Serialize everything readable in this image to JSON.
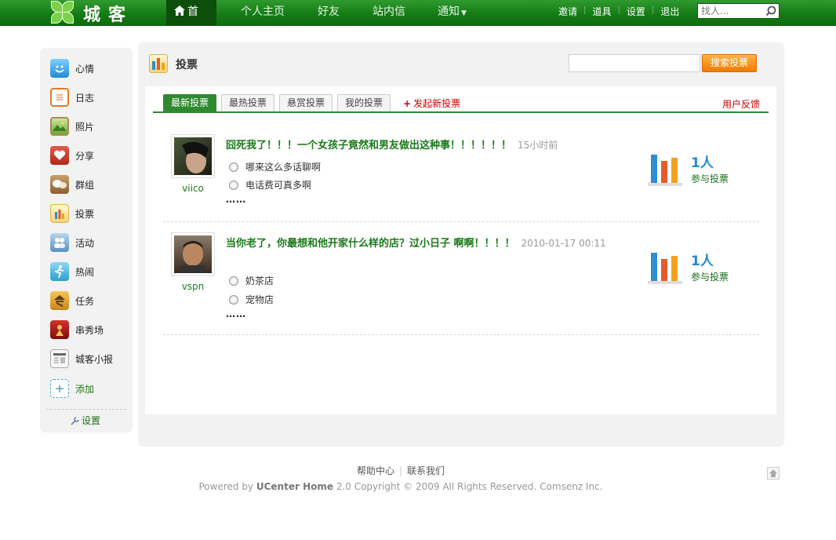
{
  "header": {
    "logo_text": "城客",
    "nav": [
      {
        "label": "首页",
        "active": true
      },
      {
        "label": "个人主页"
      },
      {
        "label": "好友"
      },
      {
        "label": "站内信"
      },
      {
        "label": "通知"
      }
    ],
    "links": [
      "邀请",
      "道具",
      "设置",
      "退出"
    ],
    "search_placeholder": "找人..."
  },
  "sidebar": {
    "items": [
      {
        "label": "心情",
        "icon": "smiley-icon"
      },
      {
        "label": "日志",
        "icon": "notepad-icon"
      },
      {
        "label": "照片",
        "icon": "photo-icon"
      },
      {
        "label": "分享",
        "icon": "heart-icon"
      },
      {
        "label": "群组",
        "icon": "chat-bubbles-icon"
      },
      {
        "label": "投票",
        "icon": "bar-chart-icon"
      },
      {
        "label": "活动",
        "icon": "people-icon"
      },
      {
        "label": "热闹",
        "icon": "runner-icon"
      },
      {
        "label": "任务",
        "icon": "task-icon"
      },
      {
        "label": "串秀场",
        "icon": "show-icon"
      },
      {
        "label": "城客小报",
        "icon": "newspaper-icon"
      }
    ],
    "add_label": "添加",
    "settings_label": "设置"
  },
  "panel": {
    "title": "投票",
    "search_button": "搜索投票",
    "tabs": [
      {
        "label": "最新投票",
        "active": true
      },
      {
        "label": "最热投票"
      },
      {
        "label": "悬赏投票"
      },
      {
        "label": "我的投票"
      }
    ],
    "new_poll": "发起新投票",
    "feedback": "用户反馈"
  },
  "polls": [
    {
      "user": "viico",
      "title": "囧死我了！！！一个女孩子竟然和男友做出这种事！！！！！！",
      "time": "15小时前",
      "options": [
        "哪来这么多话聊啊",
        "电话费可真多啊"
      ],
      "more": "……",
      "count": "1人",
      "count_label": "参与投票"
    },
    {
      "user": "vspn",
      "title": "当你老了，你最想和他开家什么样的店？过小日子 啊啊！！！！",
      "time": "2010-01-17 00:11",
      "options": [
        "奶茶店",
        "宠物店"
      ],
      "more": "……",
      "count": "1人",
      "count_label": "参与投票"
    }
  ],
  "footer": {
    "links": [
      "帮助中心",
      "联系我们"
    ],
    "copy_prefix": "Powered by ",
    "copy_brand": "UCenter Home",
    "copy_rest": " 2.0 Copyright © 2009 All Rights Reserved. Comsenz Inc."
  }
}
